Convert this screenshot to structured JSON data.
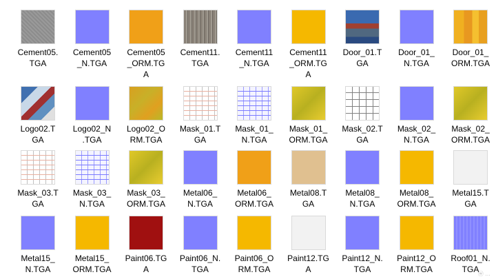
{
  "files": [
    {
      "name": "Cement05.\nTGA",
      "tex": "concrete-gray"
    },
    {
      "name": "Cement05\n_N.TGA",
      "tex": "normal-flat"
    },
    {
      "name": "Cement05\n_ORM.TG\nA",
      "tex": "orm-orange"
    },
    {
      "name": "Cement11.\nTGA",
      "tex": "concrete-streaked"
    },
    {
      "name": "Cement11\n_N.TGA",
      "tex": "normal-flat"
    },
    {
      "name": "Cement11\n_ORM.TG\nA",
      "tex": "orm-gold"
    },
    {
      "name": "Door_01.T\nGA",
      "tex": "door-atlas"
    },
    {
      "name": "Door_01_\nN.TGA",
      "tex": "normal-flat"
    },
    {
      "name": "Door_01_\nORM.TGA",
      "tex": "orm-patchy"
    },
    {
      "name": "Logo02.T\nGA",
      "tex": "logo-atlas"
    },
    {
      "name": "Logo02_N\n.TGA",
      "tex": "normal-flat"
    },
    {
      "name": "Logo02_O\nRM.TGA",
      "tex": "orm-green-patchy"
    },
    {
      "name": "Mask_01.T\nGA",
      "tex": "mask-sheet"
    },
    {
      "name": "Mask_01_\nN.TGA",
      "tex": "mask-normal"
    },
    {
      "name": "Mask_01_\nORM.TGA",
      "tex": "orm-olive"
    },
    {
      "name": "Mask_02.T\nGA",
      "tex": "mask-grid"
    },
    {
      "name": "Mask_02_\nN.TGA",
      "tex": "normal-flat"
    },
    {
      "name": "Mask_02_\nORM.TGA",
      "tex": "orm-olive"
    },
    {
      "name": "Mask_03.T\nGA",
      "tex": "mask-sheet"
    },
    {
      "name": "Mask_03_\nN.TGA",
      "tex": "mask-normal"
    },
    {
      "name": "Mask_03_\nORM.TGA",
      "tex": "orm-olive"
    },
    {
      "name": "Metal06_\nN.TGA",
      "tex": "normal-flat"
    },
    {
      "name": "Metal06_\nORM.TGA",
      "tex": "orm-orange"
    },
    {
      "name": "Metal08.T\nGA",
      "tex": "sand"
    },
    {
      "name": "Metal08_\nN.TGA",
      "tex": "normal-flat"
    },
    {
      "name": "Metal08_\nORM.TGA",
      "tex": "orm-gold"
    },
    {
      "name": "Metal15.T\nGA",
      "tex": "white"
    },
    {
      "name": "Metal15_\nN.TGA",
      "tex": "normal-flat"
    },
    {
      "name": "Metal15_\nORM.TGA",
      "tex": "orm-gold"
    },
    {
      "name": "Paint06.TG\nA",
      "tex": "red"
    },
    {
      "name": "Paint06_N.\nTGA",
      "tex": "normal-flat"
    },
    {
      "name": "Paint06_O\nRM.TGA",
      "tex": "orm-gold"
    },
    {
      "name": "Paint12.TG\nA",
      "tex": "white"
    },
    {
      "name": "Paint12_N.\nTGA",
      "tex": "normal-flat"
    },
    {
      "name": "Paint12_O\nRM.TGA",
      "tex": "orm-gold"
    },
    {
      "name": "Roof01_N.\nTGA",
      "tex": "normal-striped"
    }
  ],
  "palette": {
    "normal": "#8080ff",
    "orm_orange": "#f0a018",
    "orm_gold": "#f5b800",
    "orm_olive": "#d8c020",
    "red": "#a01010",
    "sand": "#e0c090",
    "concrete": "#9a9a9a"
  }
}
